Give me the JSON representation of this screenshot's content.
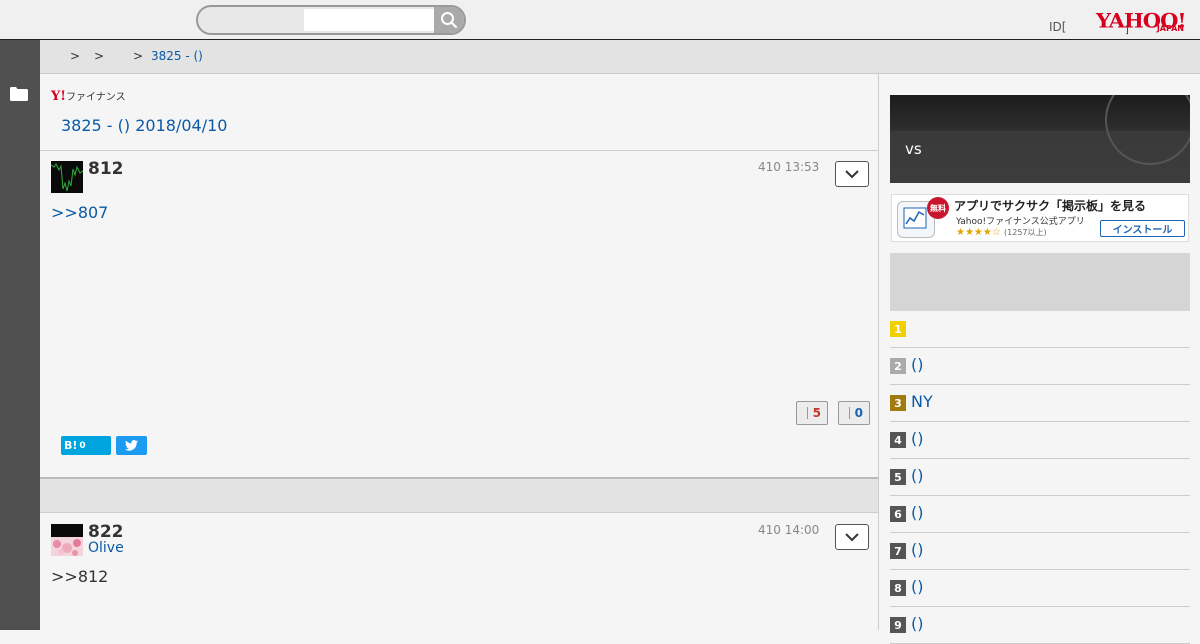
{
  "header": {
    "search_placeholder": "",
    "id_link": "ID[",
    "yahoo_logo_main": "YAHOO!",
    "yahoo_logo_sub": "JAPAN",
    "logo_tick": "]"
  },
  "breadcrumb": {
    "sep1": ">",
    "sep2": ">",
    "sep3": ">",
    "current": "3825 - ()"
  },
  "main": {
    "finance_logo_y": "Y!",
    "finance_logo_text": "ファイナンス",
    "title": "3825 - () 2018/04/10",
    "posts": [
      {
        "number": "812",
        "author": "",
        "date": "410 13:53",
        "body": ">>807",
        "likes": "5",
        "dislikes": "0",
        "hatena_count": "0",
        "hatena_label": "B!"
      },
      {
        "number": "822",
        "author": "Olive",
        "date": "410 14:00",
        "body": ">>812"
      }
    ]
  },
  "right": {
    "vs_banner": "vs",
    "app_ad": {
      "free_badge": "無料",
      "title": "アプリでサクサク「掲示板」を見る",
      "subtitle": "Yahoo!ファイナンス公式アプリ",
      "stars": "★★★★☆",
      "reviews": "(1257以上)",
      "install": "インストール"
    },
    "ranking": [
      {
        "rank": "1",
        "label": "",
        "color": "#f0d000"
      },
      {
        "rank": "2",
        "label": "()",
        "color": "#aaaaaa"
      },
      {
        "rank": "3",
        "label": "NY",
        "color": "#a07c10"
      },
      {
        "rank": "4",
        "label": "()",
        "color": "#555555"
      },
      {
        "rank": "5",
        "label": "()",
        "color": "#555555"
      },
      {
        "rank": "6",
        "label": "()",
        "color": "#555555"
      },
      {
        "rank": "7",
        "label": "()",
        "color": "#555555"
      },
      {
        "rank": "8",
        "label": "()",
        "color": "#555555"
      },
      {
        "rank": "9",
        "label": "()",
        "color": "#555555"
      }
    ]
  },
  "colors": {
    "link": "#0b5aa5",
    "yahoo_red": "#d8001f",
    "sidebar": "#505050"
  }
}
